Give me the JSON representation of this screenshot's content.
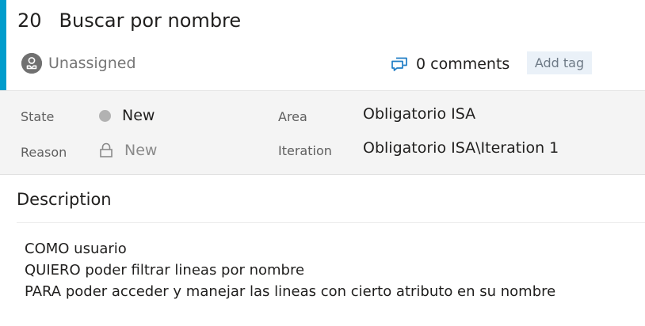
{
  "work_item": {
    "id": "20",
    "title": "Buscar por nombre",
    "assigned_to": "Unassigned",
    "comments_label": "0 comments",
    "add_tag_label": "Add tag",
    "accent_color": "#009ccc"
  },
  "fields": {
    "state_label": "State",
    "state_value": "New",
    "reason_label": "Reason",
    "reason_value": "New",
    "area_label": "Area",
    "area_value": "Obligatorio ISA",
    "iteration_label": "Iteration",
    "iteration_value": "Obligatorio ISA\\Iteration 1"
  },
  "description": {
    "header": "Description",
    "lines": [
      "COMO usuario",
      "QUIERO poder filtrar lineas por nombre",
      "PARA poder acceder y manejar las lineas con cierto atributo en su nombre"
    ]
  },
  "icons": {
    "avatar": "person-avatar-icon",
    "comments": "comments-icon",
    "state": "state-dot-icon",
    "reason": "lock-icon"
  }
}
